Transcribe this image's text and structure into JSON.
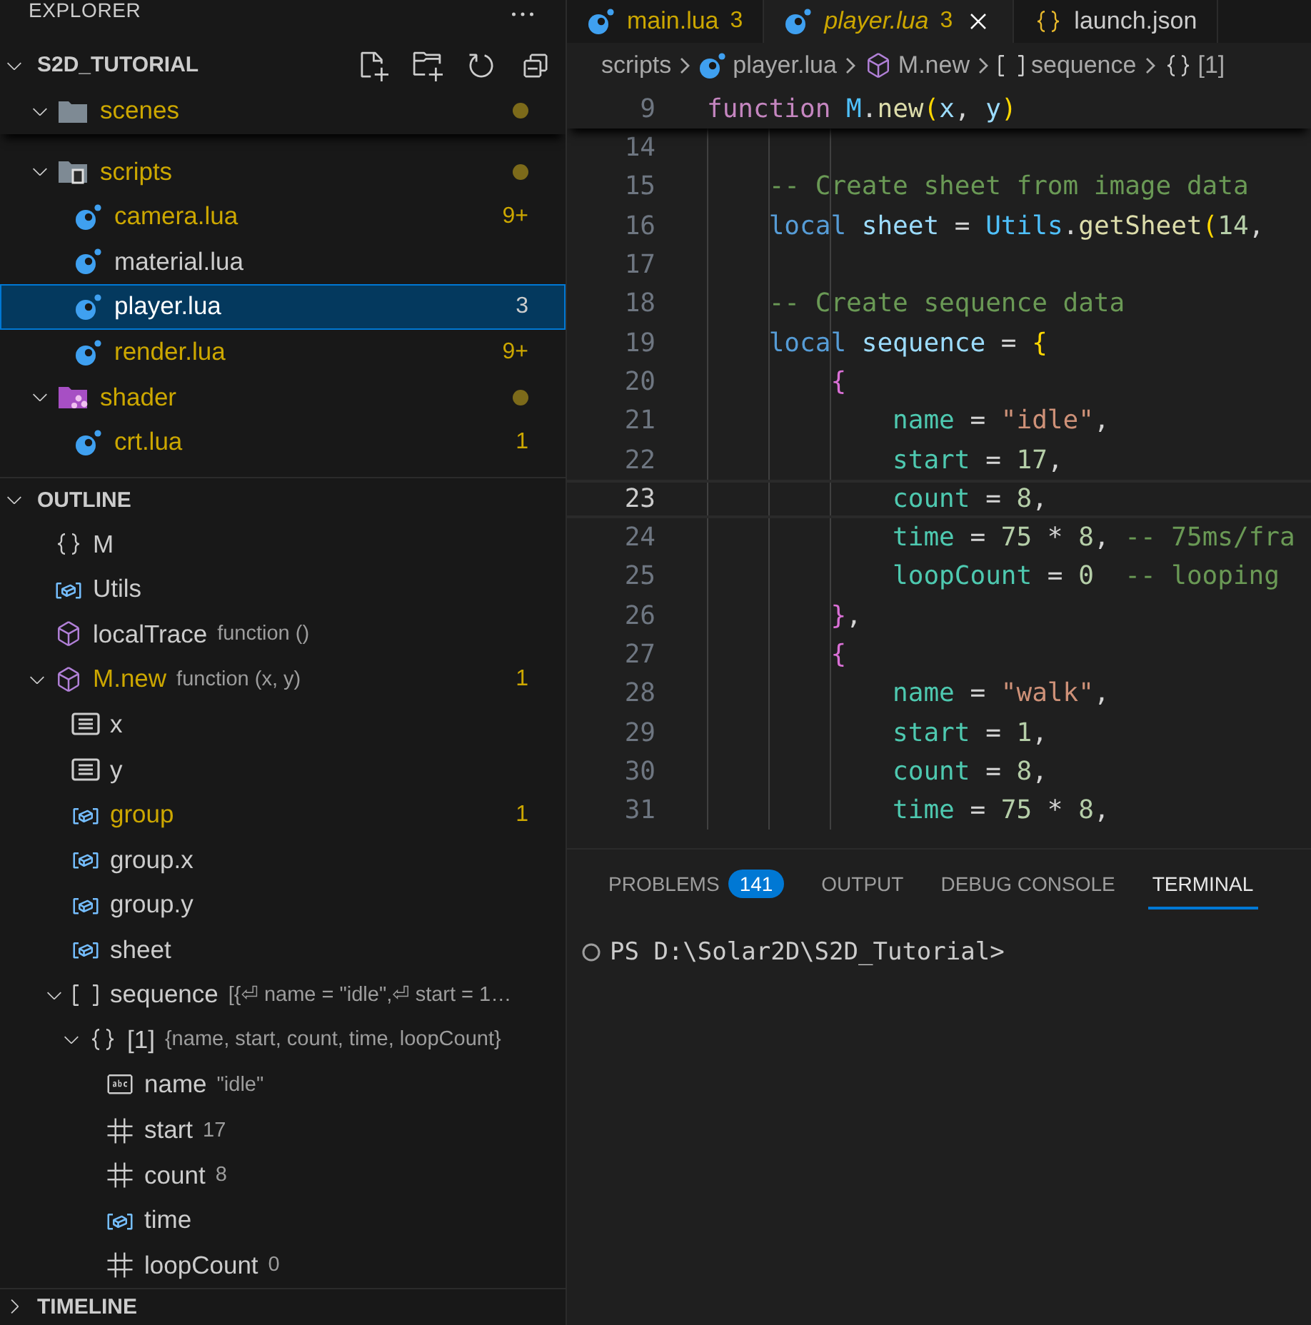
{
  "explorer": {
    "title": "EXPLORER",
    "workspace": {
      "name": "S2D_TUTORIAL",
      "expanded": true
    },
    "tree": [
      {
        "kind": "folder",
        "name": "scenes",
        "expanded": true,
        "dot": true,
        "modified": true
      },
      {
        "kind": "folder-scripts",
        "name": "scripts",
        "expanded": true,
        "dot": true,
        "modified": true,
        "children": [
          {
            "name": "camera.lua",
            "badge": "9+",
            "modified": true,
            "selected": false
          },
          {
            "name": "material.lua",
            "modified": false,
            "selected": false
          },
          {
            "name": "player.lua",
            "badge": "3",
            "modified": false,
            "selected": true
          },
          {
            "name": "render.lua",
            "badge": "9+",
            "modified": true,
            "selected": false
          }
        ]
      },
      {
        "kind": "folder-shader",
        "name": "shader",
        "expanded": true,
        "dot": true,
        "modified": true,
        "children": [
          {
            "name": "crt.lua",
            "badge": "1",
            "modified": true,
            "selected": false
          }
        ]
      }
    ]
  },
  "outline": {
    "title": "OUTLINE",
    "expanded": true,
    "items": [
      {
        "kind": "object",
        "name": "M"
      },
      {
        "kind": "variable",
        "name": "Utils"
      },
      {
        "kind": "function",
        "name": "localTrace",
        "detail": "function ()"
      },
      {
        "kind": "function",
        "name": "M.new",
        "detail": "function (x, y)",
        "warning": true,
        "badge": "1",
        "expanded": true,
        "children": [
          {
            "kind": "field",
            "name": "x"
          },
          {
            "kind": "field",
            "name": "y"
          },
          {
            "kind": "variable",
            "name": "group",
            "warning": true,
            "badge": "1"
          },
          {
            "kind": "variable",
            "name": "group.x"
          },
          {
            "kind": "variable",
            "name": "group.y"
          },
          {
            "kind": "variable",
            "name": "sheet"
          },
          {
            "kind": "array",
            "name": "sequence",
            "detail": "[{⏎ name = \"idle\",⏎ start = 1…",
            "expanded": true,
            "children": [
              {
                "kind": "object",
                "name": "[1]",
                "detail": "{name, start, count, time, loopCount}",
                "expanded": true,
                "children": [
                  {
                    "kind": "string",
                    "name": "name",
                    "detail": "\"idle\""
                  },
                  {
                    "kind": "number",
                    "name": "start",
                    "detail": "17"
                  },
                  {
                    "kind": "number",
                    "name": "count",
                    "detail": "8"
                  },
                  {
                    "kind": "variable",
                    "name": "time"
                  },
                  {
                    "kind": "number",
                    "name": "loopCount",
                    "detail": "0"
                  }
                ]
              }
            ]
          }
        ]
      }
    ]
  },
  "timeline": {
    "title": "TIMELINE",
    "expanded": false
  },
  "tabs": [
    {
      "name": "main.lua",
      "badge": "3",
      "kind": "lua",
      "modified": true,
      "selected": false
    },
    {
      "name": "player.lua",
      "badge": "3",
      "kind": "lua",
      "modified": true,
      "selected": true
    },
    {
      "name": "launch.json",
      "kind": "json",
      "modified": false,
      "selected": false
    }
  ],
  "breadcrumb": [
    {
      "kind": "folder",
      "label": "scripts"
    },
    {
      "kind": "file",
      "label": "player.lua"
    },
    {
      "kind": "function",
      "label": "M.new"
    },
    {
      "kind": "array",
      "label": "sequence"
    },
    {
      "kind": "object",
      "label": "[1]"
    }
  ],
  "sticky": {
    "n": "9",
    "tokens": [
      {
        "kind": "ctrl",
        "text": "function"
      },
      {
        "kind": "global",
        "text": " M"
      },
      {
        "kind": "op",
        "text": "."
      },
      {
        "kind": "fn",
        "text": "new"
      },
      {
        "kind": "b1",
        "text": "("
      },
      {
        "kind": "param",
        "text": "x"
      },
      {
        "kind": "op",
        "text": ", "
      },
      {
        "kind": "param",
        "text": "y"
      },
      {
        "kind": "b1",
        "text": ")"
      }
    ]
  },
  "code": [
    {
      "n": "14",
      "current": false
    },
    {
      "n": "15",
      "current": false,
      "tokens": [
        {
          "kind": "cmt",
          "text": "    -- Create sheet from image data"
        }
      ]
    },
    {
      "n": "16",
      "current": false,
      "tokens": [
        {
          "kind": "kw",
          "text": "    local"
        },
        {
          "kind": "var",
          "text": " sheet"
        },
        {
          "kind": "op",
          "text": " = "
        },
        {
          "kind": "global",
          "text": "Utils"
        },
        {
          "kind": "op",
          "text": "."
        },
        {
          "kind": "fn",
          "text": "getSheet"
        },
        {
          "kind": "b1",
          "text": "("
        },
        {
          "kind": "num",
          "text": "14"
        },
        {
          "kind": "op",
          "text": ","
        }
      ]
    },
    {
      "n": "17",
      "current": false
    },
    {
      "n": "18",
      "current": false,
      "tokens": [
        {
          "kind": "cmt",
          "text": "    -- Create sequence data"
        }
      ]
    },
    {
      "n": "19",
      "current": false,
      "tokens": [
        {
          "kind": "kw",
          "text": "    local"
        },
        {
          "kind": "var",
          "text": " sequence"
        },
        {
          "kind": "op",
          "text": " = "
        },
        {
          "kind": "b1",
          "text": "{"
        }
      ]
    },
    {
      "n": "20",
      "current": false,
      "tokens": [
        {
          "kind": "b2",
          "text": "        {"
        }
      ]
    },
    {
      "n": "21",
      "current": false,
      "tokens": [
        {
          "kind": "field",
          "text": "            name"
        },
        {
          "kind": "op",
          "text": " = "
        },
        {
          "kind": "str",
          "text": "\"idle\""
        },
        {
          "kind": "op",
          "text": ","
        }
      ]
    },
    {
      "n": "22",
      "current": false,
      "tokens": [
        {
          "kind": "field",
          "text": "            start"
        },
        {
          "kind": "op",
          "text": " = "
        },
        {
          "kind": "num",
          "text": "17"
        },
        {
          "kind": "op",
          "text": ","
        }
      ]
    },
    {
      "n": "23",
      "current": true,
      "tokens": [
        {
          "kind": "field",
          "text": "            count"
        },
        {
          "kind": "op",
          "text": " = "
        },
        {
          "kind": "num",
          "text": "8"
        },
        {
          "kind": "op",
          "text": ","
        }
      ]
    },
    {
      "n": "24",
      "current": false,
      "tokens": [
        {
          "kind": "field",
          "text": "            time"
        },
        {
          "kind": "op",
          "text": " = "
        },
        {
          "kind": "num",
          "text": "75"
        },
        {
          "kind": "op",
          "text": " * "
        },
        {
          "kind": "num",
          "text": "8"
        },
        {
          "kind": "op",
          "text": ","
        },
        {
          "kind": "cmt",
          "text": " -- 75ms/fra"
        }
      ]
    },
    {
      "n": "25",
      "current": false,
      "tokens": [
        {
          "kind": "field",
          "text": "            loopCount"
        },
        {
          "kind": "op",
          "text": " = "
        },
        {
          "kind": "num",
          "text": "0"
        },
        {
          "kind": "cmt",
          "text": "  -- looping"
        }
      ]
    },
    {
      "n": "26",
      "current": false,
      "tokens": [
        {
          "kind": "b2",
          "text": "        }"
        },
        {
          "kind": "op",
          "text": ","
        }
      ]
    },
    {
      "n": "27",
      "current": false,
      "tokens": [
        {
          "kind": "b2",
          "text": "        {"
        }
      ]
    },
    {
      "n": "28",
      "current": false,
      "tokens": [
        {
          "kind": "field",
          "text": "            name"
        },
        {
          "kind": "op",
          "text": " = "
        },
        {
          "kind": "str",
          "text": "\"walk\""
        },
        {
          "kind": "op",
          "text": ","
        }
      ]
    },
    {
      "n": "29",
      "current": false,
      "tokens": [
        {
          "kind": "field",
          "text": "            start"
        },
        {
          "kind": "op",
          "text": " = "
        },
        {
          "kind": "num",
          "text": "1"
        },
        {
          "kind": "op",
          "text": ","
        }
      ]
    },
    {
      "n": "30",
      "current": false,
      "tokens": [
        {
          "kind": "field",
          "text": "            count"
        },
        {
          "kind": "op",
          "text": " = "
        },
        {
          "kind": "num",
          "text": "8"
        },
        {
          "kind": "op",
          "text": ","
        }
      ]
    },
    {
      "n": "31",
      "current": false,
      "tokens": [
        {
          "kind": "field",
          "text": "            time"
        },
        {
          "kind": "op",
          "text": " = "
        },
        {
          "kind": "num",
          "text": "75"
        },
        {
          "kind": "op",
          "text": " * "
        },
        {
          "kind": "num",
          "text": "8"
        },
        {
          "kind": "op",
          "text": ","
        }
      ]
    }
  ],
  "panel": {
    "tabs": [
      {
        "label": "PROBLEMS",
        "badge": "141",
        "selected": false
      },
      {
        "label": "OUTPUT",
        "selected": false
      },
      {
        "label": "DEBUG CONSOLE",
        "selected": false
      },
      {
        "label": "TERMINAL",
        "selected": true
      }
    ],
    "terminal": {
      "prompt": "PS D:\\Solar2D\\S2D_Tutorial>"
    }
  }
}
